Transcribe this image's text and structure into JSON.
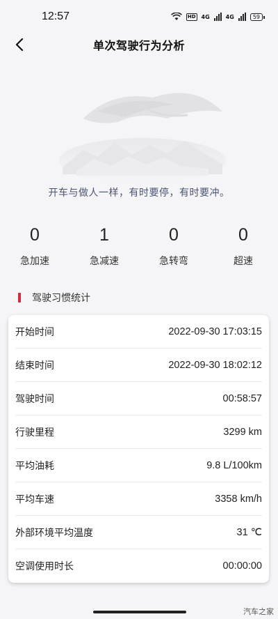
{
  "status_bar": {
    "time": "12:57",
    "hd_label": "HD",
    "net1": "4G",
    "net2": "4G",
    "battery": "59"
  },
  "nav": {
    "title": "单次驾驶行为分析",
    "back_icon": "chevron-left-icon"
  },
  "slogan": "开车与做人一样，有时要停，有时要冲。",
  "stats": [
    {
      "value": "0",
      "label": "急加速"
    },
    {
      "value": "1",
      "label": "急减速"
    },
    {
      "value": "0",
      "label": "急转弯"
    },
    {
      "value": "0",
      "label": "超速"
    }
  ],
  "section": {
    "title": "驾驶习惯统计",
    "accent_color": "#d42a3c"
  },
  "details": [
    {
      "label": "开始时间",
      "value": "2022-09-30 17:03:15"
    },
    {
      "label": "结束时间",
      "value": "2022-09-30 18:02:12"
    },
    {
      "label": "驾驶时间",
      "value": "00:58:57"
    },
    {
      "label": "行驶里程",
      "value": "3299 km"
    },
    {
      "label": "平均油耗",
      "value": "9.8 L/100km"
    },
    {
      "label": "平均车速",
      "value": "3358 km/h"
    },
    {
      "label": "外部环境平均温度",
      "value": "31 ℃"
    },
    {
      "label": "空调使用时长",
      "value": "00:00:00"
    }
  ],
  "watermark": "汽车之家"
}
